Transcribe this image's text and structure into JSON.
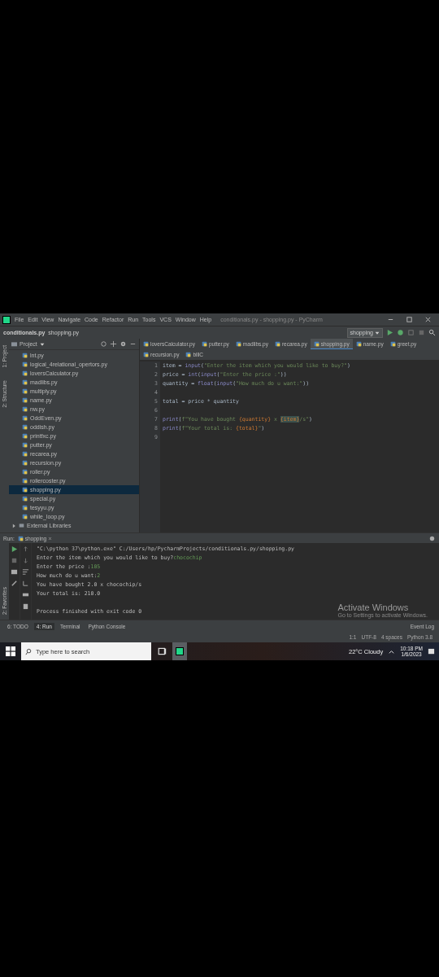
{
  "window": {
    "title": "conditionals.py - shopping.py - PyCharm",
    "menu": [
      "File",
      "Edit",
      "View",
      "Navigate",
      "Code",
      "Refactor",
      "Run",
      "Tools",
      "VCS",
      "Window",
      "Help"
    ]
  },
  "breadcrumbs": [
    "conditionals.py",
    "shopping.py"
  ],
  "run_config": {
    "label": "shopping"
  },
  "side_tabs": [
    "1: Project",
    "2: Structure"
  ],
  "project": {
    "title": "Project",
    "files": [
      {
        "name": "lnt.py",
        "selected": false
      },
      {
        "name": "logical_4relational_opertors.py",
        "selected": false
      },
      {
        "name": "loversCalculator.py",
        "selected": false
      },
      {
        "name": "madlibs.py",
        "selected": false
      },
      {
        "name": "multiply.py",
        "selected": false
      },
      {
        "name": "name.py",
        "selected": false
      },
      {
        "name": "nw.py",
        "selected": false
      },
      {
        "name": "OddEven.py",
        "selected": false
      },
      {
        "name": "oddish.py",
        "selected": false
      },
      {
        "name": "printfxc.py",
        "selected": false
      },
      {
        "name": "putter.py",
        "selected": false
      },
      {
        "name": "recarea.py",
        "selected": false
      },
      {
        "name": "recursion.py",
        "selected": false
      },
      {
        "name": "roller.py",
        "selected": false
      },
      {
        "name": "rollercoster.py",
        "selected": false
      },
      {
        "name": "shopping.py",
        "selected": true
      },
      {
        "name": "special.py",
        "selected": false
      },
      {
        "name": "tesyyu.py",
        "selected": false
      },
      {
        "name": "while_loop.py",
        "selected": false
      }
    ],
    "external": "External Libraries"
  },
  "editor": {
    "tabs": [
      {
        "label": "loversCalculator.py",
        "selected": false
      },
      {
        "label": "putter.py",
        "selected": false
      },
      {
        "label": "madlibs.py",
        "selected": false
      },
      {
        "label": "recarea.py",
        "selected": false
      },
      {
        "label": "shopping.py",
        "selected": true
      },
      {
        "label": "name.py",
        "selected": false
      },
      {
        "label": "greet.py",
        "selected": false
      },
      {
        "label": "recursion.py",
        "selected": false
      },
      {
        "label": "blllC",
        "selected": false
      }
    ],
    "lines": [
      {
        "number": "1",
        "tokens": [
          {
            "text": "item = ",
            "kind": "plain"
          },
          {
            "text": "input",
            "kind": "func"
          },
          {
            "text": "(",
            "kind": "plain"
          },
          {
            "text": "\"Enter the item which you would like to buy?\"",
            "kind": "string"
          },
          {
            "text": ")",
            "kind": "plain"
          }
        ]
      },
      {
        "number": "2",
        "tokens": [
          {
            "text": "price = ",
            "kind": "plain"
          },
          {
            "text": "int",
            "kind": "func"
          },
          {
            "text": "(",
            "kind": "plain"
          },
          {
            "text": "input",
            "kind": "func"
          },
          {
            "text": "(",
            "kind": "plain"
          },
          {
            "text": "\"Enter the price :\"",
            "kind": "string"
          },
          {
            "text": "))",
            "kind": "plain"
          }
        ]
      },
      {
        "number": "3",
        "tokens": [
          {
            "text": "quantity = ",
            "kind": "plain"
          },
          {
            "text": "float",
            "kind": "func"
          },
          {
            "text": "(",
            "kind": "plain"
          },
          {
            "text": "input",
            "kind": "func"
          },
          {
            "text": "(",
            "kind": "plain"
          },
          {
            "text": "\"How much do u want:\"",
            "kind": "string"
          },
          {
            "text": "))",
            "kind": "plain"
          }
        ]
      },
      {
        "number": "4"
      },
      {
        "number": "5",
        "tokens": [
          {
            "text": "total = price * quantity",
            "kind": "plain"
          }
        ]
      },
      {
        "number": "6"
      },
      {
        "number": "7",
        "tokens": [
          {
            "text": "print",
            "kind": "func"
          },
          {
            "text": "(",
            "kind": "plain"
          },
          {
            "text": "f\"You have bought ",
            "kind": "string"
          },
          {
            "text": "{quantity}",
            "kind": "brace"
          },
          {
            "text": " x ",
            "kind": "string"
          },
          {
            "text": "{item}",
            "kind": "highlight"
          },
          {
            "text": "/s\"",
            "kind": "string"
          },
          {
            "text": ")",
            "kind": "plain"
          }
        ]
      },
      {
        "number": "8",
        "tokens": [
          {
            "text": "print",
            "kind": "func"
          },
          {
            "text": "(",
            "kind": "plain"
          },
          {
            "text": "f\"Your total is: ",
            "kind": "string"
          },
          {
            "text": "{total}",
            "kind": "brace"
          },
          {
            "text": "\"",
            "kind": "string"
          },
          {
            "text": ")",
            "kind": "plain"
          }
        ]
      },
      {
        "number": "9"
      }
    ]
  },
  "run": {
    "label": "Run:",
    "tab": "shopping",
    "side_tab": "2: Favorites",
    "output": [
      {
        "tokens": [
          {
            "text": "\"C:\\python 37\\python.exe\" C:/Users/hp/PycharmProjects/conditionals.py/shopping.py",
            "kind": "plain"
          }
        ]
      },
      {
        "tokens": [
          {
            "text": "Enter the item which you would like to buy?",
            "kind": "plain"
          },
          {
            "text": "chocochip",
            "kind": "input"
          }
        ]
      },
      {
        "tokens": [
          {
            "text": "Enter the price :",
            "kind": "plain"
          },
          {
            "text": "105",
            "kind": "input"
          }
        ]
      },
      {
        "tokens": [
          {
            "text": "How much do u want:",
            "kind": "plain"
          },
          {
            "text": "2",
            "kind": "input"
          }
        ]
      },
      {
        "tokens": [
          {
            "text": "You have bought 2.0 x chocochip/s",
            "kind": "plain"
          }
        ]
      },
      {
        "tokens": [
          {
            "text": "Your total is: 210.0",
            "kind": "plain"
          }
        ]
      },
      {
        "kind": "exit",
        "tokens": [
          {
            "text": "Process finished with exit code 0",
            "kind": "plain"
          }
        ]
      }
    ]
  },
  "tool_tabs": [
    {
      "label": "6: TODO",
      "selected": false
    },
    {
      "label": "4: Run",
      "selected": true
    },
    {
      "label": "Terminal",
      "selected": false
    },
    {
      "label": "Python Console",
      "selected": false
    }
  ],
  "event_log": "Event Log",
  "activation": {
    "title": "Activate Windows",
    "subtitle": "Go to Settings to activate Windows."
  },
  "status": [
    "1:1",
    "UTF-8",
    "4 spaces",
    "Python 3.8"
  ],
  "taskbar": {
    "search_placeholder": "Type here to search",
    "weather": "22°C  Cloudy",
    "time": "10:18 PM",
    "date": "1/6/2023"
  }
}
